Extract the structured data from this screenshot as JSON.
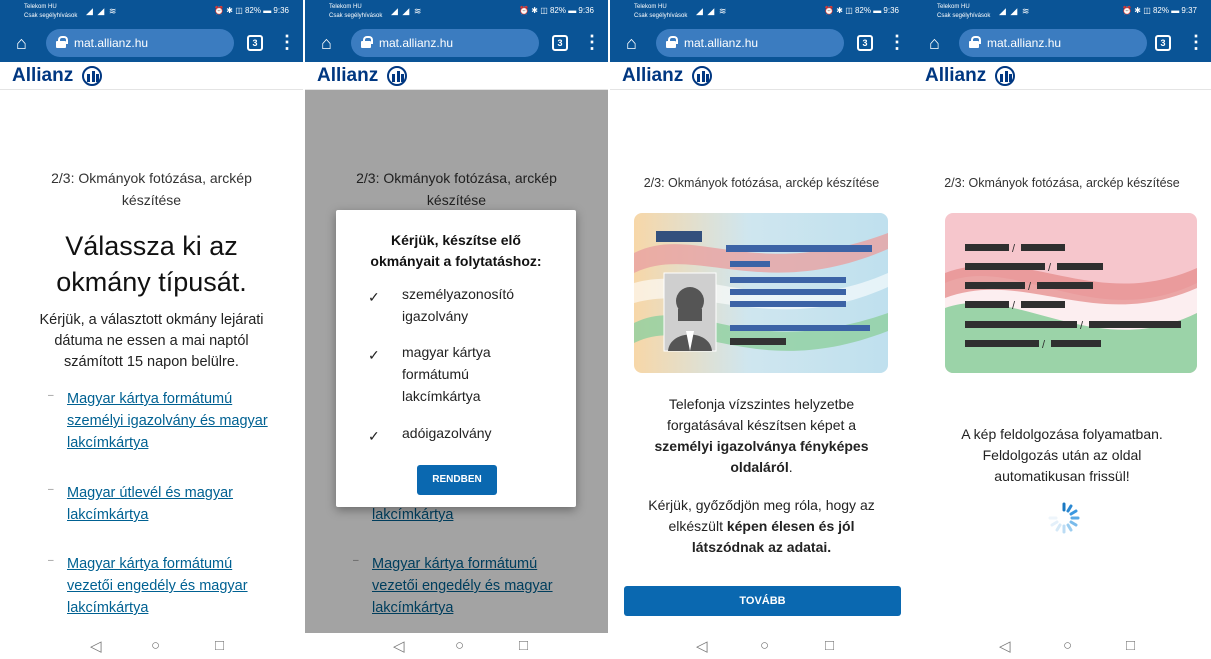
{
  "status_bar": {
    "carrier_line1": "Telekom HU",
    "carrier_line2": "Csak segélyhívások",
    "right_p1": "⏰ ✱ ◫ 82% ▬ 9:36",
    "right_p4": "⏰ ✱ ◫ 82% ▬ 9:37"
  },
  "browser": {
    "url": "mat.allianz.hu",
    "tab_count": "3"
  },
  "logo": {
    "text": "Allianz"
  },
  "common": {
    "step_title_wrap_1": "2/3: Okmányok fotózása, arckép",
    "step_title_wrap_2": "készítése",
    "step_title": "2/3: Okmányok fotózása, arckép készítése"
  },
  "panel1": {
    "headline_1": "Válassza ki az",
    "headline_2": "okmány típusát.",
    "notice_1": "Kérjük, a választott okmány lejárati",
    "notice_2": "dátuma ne essen a mai naptól",
    "notice_3": "számított 15 napon belülre.",
    "links": [
      [
        "Magyar kártya formátumú",
        "személyi igazolvány és magyar",
        "lakcímkártya"
      ],
      [
        "Magyar útlevél és magyar",
        "lakcímkártya"
      ],
      [
        "Magyar kártya formátumú",
        "vezetői engedély és magyar",
        "lakcímkártya"
      ]
    ]
  },
  "panel2": {
    "dialog_title_1": "Kérjük, készítse elő",
    "dialog_title_2": "okmányait a folytatáshoz:",
    "items": [
      [
        "személyazonosító",
        "igazolvány"
      ],
      [
        "magyar kártya",
        "formátumú",
        "lakcímkártya"
      ],
      [
        "adóigazolvány"
      ]
    ],
    "ok_button": "RENDBEN",
    "bg_link_partial": "lakcímkártya",
    "bg_links": [
      "Magyar kártya formátumú",
      "vezetői engedély és magyar",
      "lakcímkártya"
    ]
  },
  "panel3": {
    "instr_1": "Telefonja vízszintes helyzetbe",
    "instr_2": "forgatásával készítsen képet a",
    "instr_3_bold": "személyi igazolványa fényképes",
    "instr_4_bold": "oldaláról",
    "instr_4_rest": ".",
    "check_1": "Kérjük, győződjön meg róla, hogy az",
    "check_2_plain": "elkészült ",
    "check_2_bold": "képen élesen és jól",
    "check_3_bold": "látszódnak az adatai.",
    "next_button": "TOVÁBB"
  },
  "panel4": {
    "processing_1": "A kép feldolgozása folyamatban.",
    "processing_2": "Feldolgozás után az oldal",
    "processing_3": "automatikusan frissül!"
  },
  "colors": {
    "brand_blue": "#003781",
    "browser_blue": "#0a5496",
    "button_blue": "#0a68b0",
    "link_blue": "#006192"
  }
}
